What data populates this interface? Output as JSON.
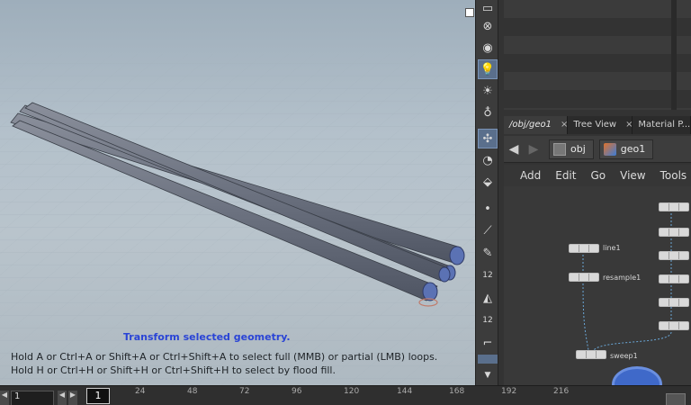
{
  "viewport": {
    "hint_title": "Transform selected geometry.",
    "hint_lines": [
      "Hold A or Ctrl+A or Shift+A or Ctrl+Shift+A to select full (MMB) or partial (LMB) loops.",
      "Hold H or Ctrl+H or Shift+H or Ctrl+Shift+H to select by flood fill."
    ]
  },
  "shelf": {
    "tools": [
      {
        "icon": "close-circle-icon",
        "glyph": "⊗"
      },
      {
        "icon": "camera-sphere-icon",
        "glyph": "◉"
      },
      {
        "icon": "light-bulb-icon",
        "glyph": "💡"
      },
      {
        "icon": "ambient-light-icon",
        "glyph": "☀"
      },
      {
        "icon": "point-light-icon",
        "glyph": "♁"
      },
      {
        "icon": "pose-tool-icon",
        "glyph": "✣"
      },
      {
        "icon": "view-eye-icon",
        "glyph": "◔"
      },
      {
        "icon": "handle-tool-icon",
        "glyph": "⬙"
      },
      {
        "icon": "point-dot-icon",
        "glyph": "•"
      },
      {
        "icon": "brush-icon",
        "glyph": "⟋"
      },
      {
        "icon": "pin-icon",
        "glyph": "✎"
      },
      {
        "icon": "snap-12-icon",
        "glyph": "12"
      },
      {
        "icon": "paint-bucket-icon",
        "glyph": "◭"
      },
      {
        "icon": "snap-12-alt-icon",
        "glyph": "12"
      },
      {
        "icon": "corner-icon",
        "glyph": "⌐"
      }
    ]
  },
  "tabs": [
    {
      "label": "/obj/geo1",
      "close": "×"
    },
    {
      "label": "Tree View",
      "close": "×"
    },
    {
      "label": "Material P...",
      "close": ""
    }
  ],
  "pathbar": {
    "obj": "obj",
    "geo": "geo1"
  },
  "menu": [
    "Add",
    "Edit",
    "Go",
    "View",
    "Tools"
  ],
  "nodes": {
    "line": "line1",
    "resample": "resample1",
    "sweep": "sweep1"
  },
  "timeline": {
    "current_frame": "1",
    "start_frame": "1",
    "ticks": [
      "24",
      "48",
      "72",
      "96",
      "120",
      "144",
      "168",
      "192",
      "216"
    ]
  }
}
